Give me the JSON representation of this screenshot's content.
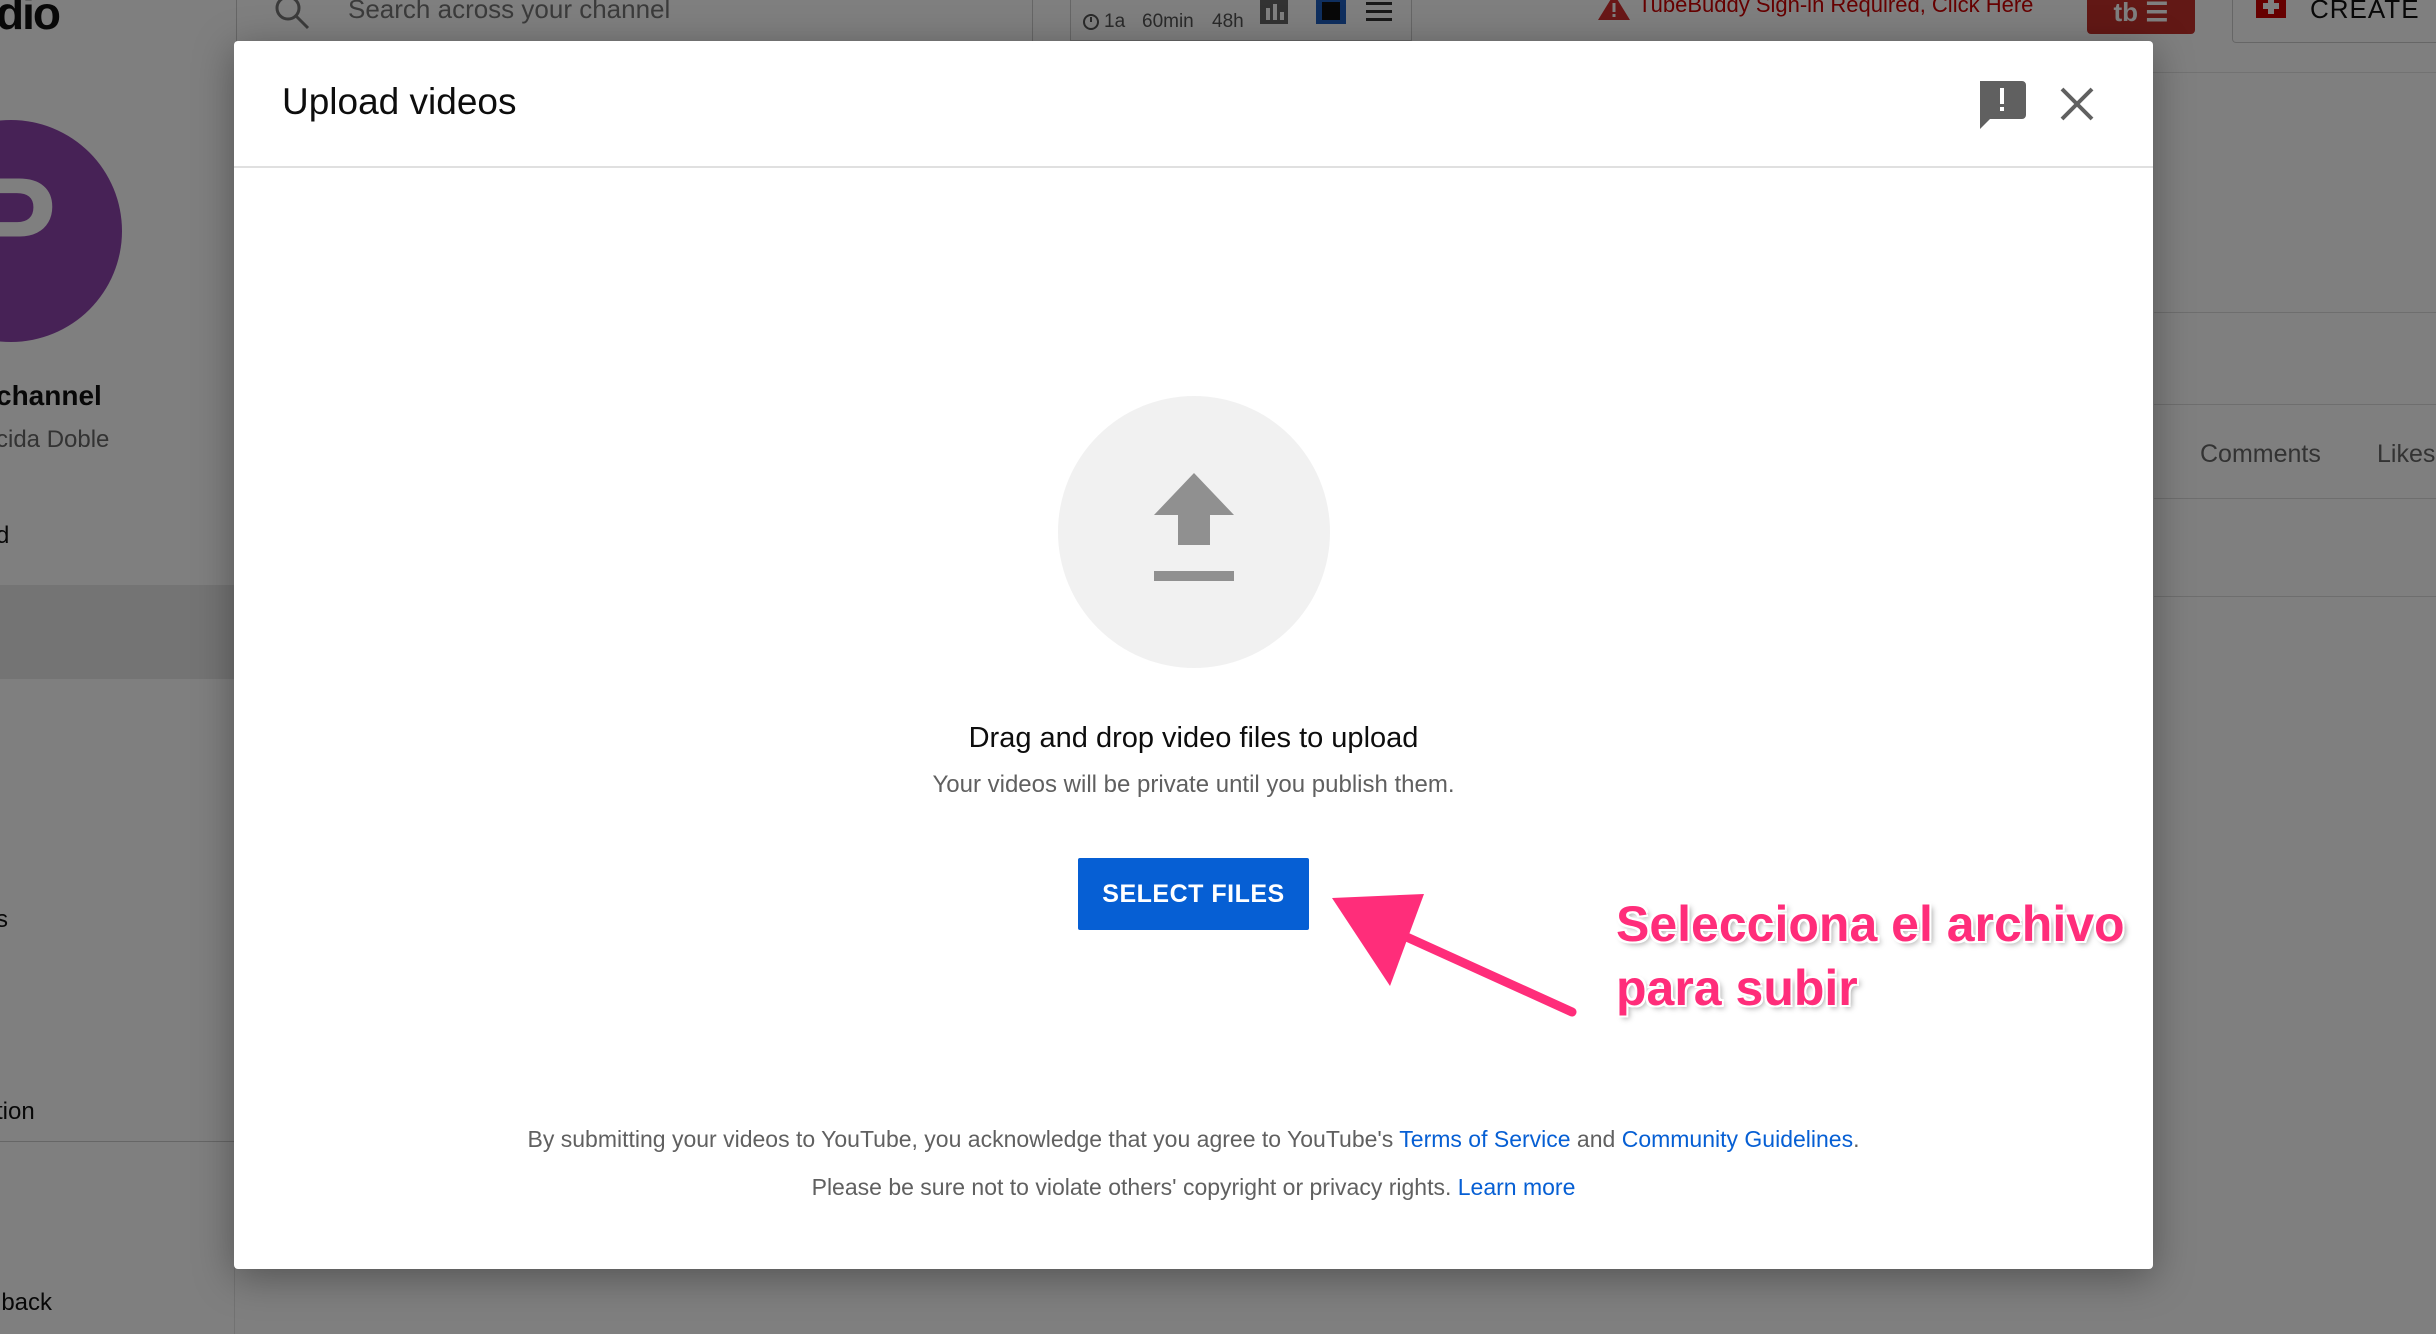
{
  "background": {
    "logo_fragment": "dio",
    "search_placeholder": "Search across your channel",
    "tb_stats": [
      "1a",
      "60min",
      "48h"
    ],
    "tubebuddy_alert": "TubeBuddy Sign-in Required, Click Here",
    "tb_button": "tb ☰",
    "create_label": "CREATE",
    "channel_name": "channel",
    "channel_sub": "cida Doble",
    "sidebar_items": [
      "d",
      "s",
      "tion",
      "lback"
    ],
    "columns": [
      "Comments",
      "Likes"
    ]
  },
  "dialog": {
    "title": "Upload videos",
    "drag_text": "Drag and drop video files to upload",
    "private_text": "Your videos will be private until you publish them.",
    "select_files": "SELECT FILES",
    "legal": {
      "prefix": "By submitting your videos to YouTube, you acknowledge that you agree to YouTube's ",
      "terms_link": "Terms of Service",
      "and": " and ",
      "guidelines_link": "Community Guidelines",
      "end": ".",
      "line2": "Please be sure not to violate others' copyright or privacy rights. ",
      "learn_more": "Learn more"
    }
  },
  "annotation": {
    "line1": "Selecciona el archivo",
    "line2": "para subir"
  },
  "colors": {
    "primary_blue": "#065fd4",
    "annotation_pink": "#ff2d7a",
    "avatar_purple": "#8e44ad"
  }
}
